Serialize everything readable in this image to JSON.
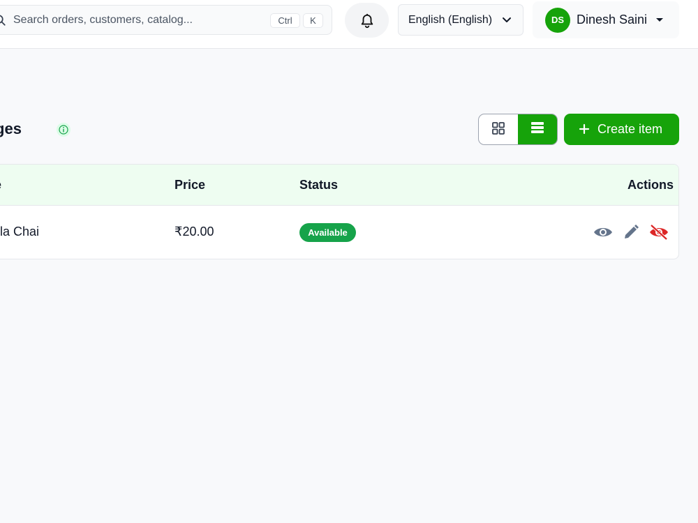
{
  "header": {
    "search": {
      "placeholder": "Search orders, customers, catalog...",
      "shortcut_ctrl": "Ctrl",
      "shortcut_key": "K"
    },
    "language": "English (English)",
    "user": {
      "initials": "DS",
      "name": "Dinesh Saini"
    },
    "icons": [
      "search-icon",
      "bell-icon",
      "chevron-down-icon",
      "caret-down-icon"
    ]
  },
  "page": {
    "title": "erages",
    "view_modes": [
      "grid",
      "list"
    ],
    "active_view": "list",
    "create_label": "Create item"
  },
  "table": {
    "columns": [
      "ne",
      "Price",
      "Status",
      "Actions"
    ],
    "rows": [
      {
        "name": "sala Chai",
        "price": "₹20.00",
        "status": "Available",
        "actions": [
          "view",
          "edit",
          "hide"
        ]
      }
    ]
  },
  "colors": {
    "accent": "#16a30a",
    "badge": "#16a34a",
    "hide_action": "#dc2626",
    "icon_gray": "#64748b"
  }
}
